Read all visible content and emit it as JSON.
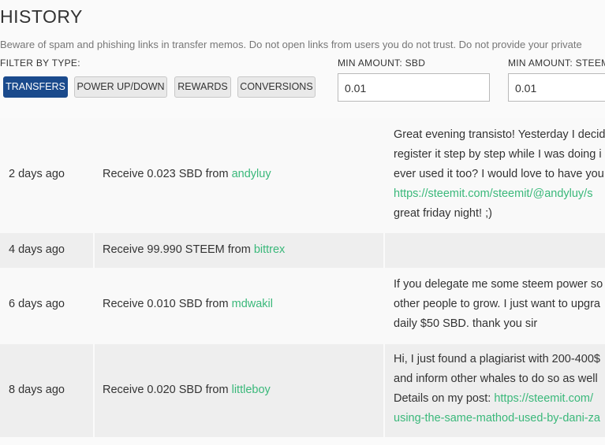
{
  "header": {
    "title": "HISTORY",
    "warning": "Beware of spam and phishing links in transfer memos. Do not open links from users you do not trust. Do not provide your private"
  },
  "filter": {
    "label": "FILTER BY TYPE:",
    "buttons": [
      {
        "label": "TRANSFERS",
        "active": true
      },
      {
        "label": "POWER UP/DOWN",
        "active": false
      },
      {
        "label": "REWARDS",
        "active": false
      },
      {
        "label": "CONVERSIONS",
        "active": false
      }
    ]
  },
  "min_amount": {
    "sbd_label": "MIN AMOUNT: SBD",
    "sbd_value": "0.01",
    "steem_label": "MIN AMOUNT: STEEM",
    "steem_value": "0.01"
  },
  "rows": [
    {
      "time": "2 days ago",
      "action": "Receive 0.023 SBD from",
      "user": "andyluy",
      "memo": [
        {
          "text": "Great evening transisto! Yesterday I decid"
        },
        {
          "text": "register it step by step while I was doing i"
        },
        {
          "text": "ever used it too? I would love to have you"
        },
        {
          "link": "https://steemit.com/steemit/@andyluy/s"
        },
        {
          "text": "great friday night! ;)"
        }
      ]
    },
    {
      "time": "4 days ago",
      "action": "Receive 99.990 STEEM from",
      "user": "bittrex",
      "memo": []
    },
    {
      "time": "6 days ago",
      "action": "Receive 0.010 SBD from",
      "user": "mdwakil",
      "memo": [
        {
          "text": "If you delegate me some steem power so"
        },
        {
          "text": "other people to grow. I just want to upgra"
        },
        {
          "text": "daily $50 SBD. thank you sir"
        }
      ]
    },
    {
      "time": "8 days ago",
      "action": "Receive 0.020 SBD from",
      "user": "littleboy",
      "memo": [
        {
          "text": "Hi, I just found a plagiarist with 200-400$"
        },
        {
          "text": "and inform other whales to do so as well"
        },
        {
          "text": "Details on my post: ",
          "link": "https://steemit.com/"
        },
        {
          "link": "using-the-same-mathod-used-by-dani-za"
        }
      ]
    }
  ],
  "colors": {
    "accent_button": "#1a4a8c",
    "link": "#3ab87a"
  }
}
